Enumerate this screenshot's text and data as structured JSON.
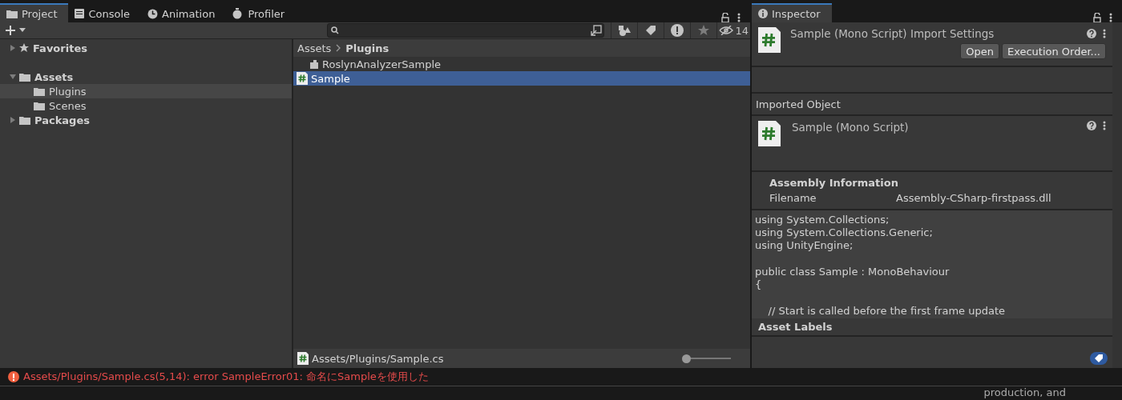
{
  "project_panel": {
    "tabs": [
      {
        "label": "Project",
        "selected": true
      },
      {
        "label": "Console",
        "selected": false
      },
      {
        "label": "Animation",
        "selected": false
      },
      {
        "label": "Profiler",
        "selected": false
      }
    ],
    "hidden_count": "14",
    "tree": [
      {
        "label": "Favorites",
        "kind": "favorites",
        "expanded": false,
        "selected": false
      },
      {
        "label": "Assets",
        "kind": "folder",
        "expanded": true,
        "selected": false,
        "children": [
          {
            "label": "Plugins",
            "selected": true
          },
          {
            "label": "Scenes",
            "selected": false
          }
        ]
      },
      {
        "label": "Packages",
        "kind": "folder",
        "expanded": false,
        "selected": false
      }
    ],
    "breadcrumb": [
      "Assets",
      "Plugins"
    ],
    "files": [
      {
        "name": "RoslynAnalyzerSample",
        "kind": "plugin",
        "selected": false
      },
      {
        "name": "Sample",
        "kind": "script",
        "selected": true
      }
    ],
    "footer_path": "Assets/Plugins/Sample.cs",
    "zoom_slider": {
      "level": 0.0
    }
  },
  "inspector": {
    "tab": "Inspector",
    "title": "Sample (Mono Script) Import Settings",
    "buttons": [
      "Open",
      "Execution Order..."
    ],
    "imported_object_heading": "Imported Object",
    "object_title": "Sample (Mono Script)",
    "assembly_heading": "Assembly Information",
    "assembly_rows": [
      {
        "label": "Filename",
        "value": "Assembly-CSharp-firstpass.dll"
      }
    ],
    "code_blocks": [
      [
        "using System.Collections;",
        "using System.Collections.Generic;",
        "using UnityEngine;"
      ],
      [
        "public class Sample : MonoBehaviour",
        "{"
      ],
      [
        "    // Start is called before the first frame update"
      ]
    ],
    "labels_heading": "Asset Labels"
  },
  "status_bar": {
    "kind": "error",
    "message": "Assets/Plugins/Sample.cs(5,14): error SampleError01: 命名にSampleを使用した"
  },
  "background_text": "production, and"
}
